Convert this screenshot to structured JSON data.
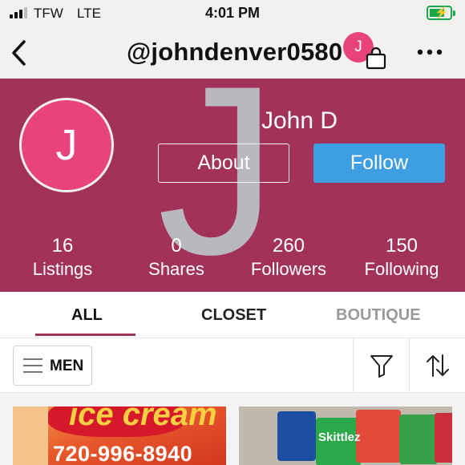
{
  "status_bar": {
    "carrier": "TFW",
    "network": "LTE",
    "time": "4:01 PM"
  },
  "nav": {
    "username": "@johndenver0580",
    "avatar_initial": "J"
  },
  "profile": {
    "initial": "J",
    "display_name": "John D",
    "about_label": "About",
    "follow_label": "Follow",
    "stats": [
      {
        "value": "16",
        "label": "Listings"
      },
      {
        "value": "0",
        "label": "Shares"
      },
      {
        "value": "260",
        "label": "Followers"
      },
      {
        "value": "150",
        "label": "Following"
      }
    ]
  },
  "tabs": [
    {
      "label": "ALL",
      "active": true
    },
    {
      "label": "CLOSET",
      "active": false
    },
    {
      "label": "BOUTIQUE",
      "active": false
    }
  ],
  "filter": {
    "category_label": "MEN"
  },
  "listings": [
    {
      "image_text": "720-996-8940"
    },
    {
      "image_text": "Skittlez"
    }
  ],
  "colors": {
    "banner": "#a2325a",
    "avatar": "#e8437b",
    "follow": "#3e9ee2",
    "battery": "#1aa94a"
  }
}
